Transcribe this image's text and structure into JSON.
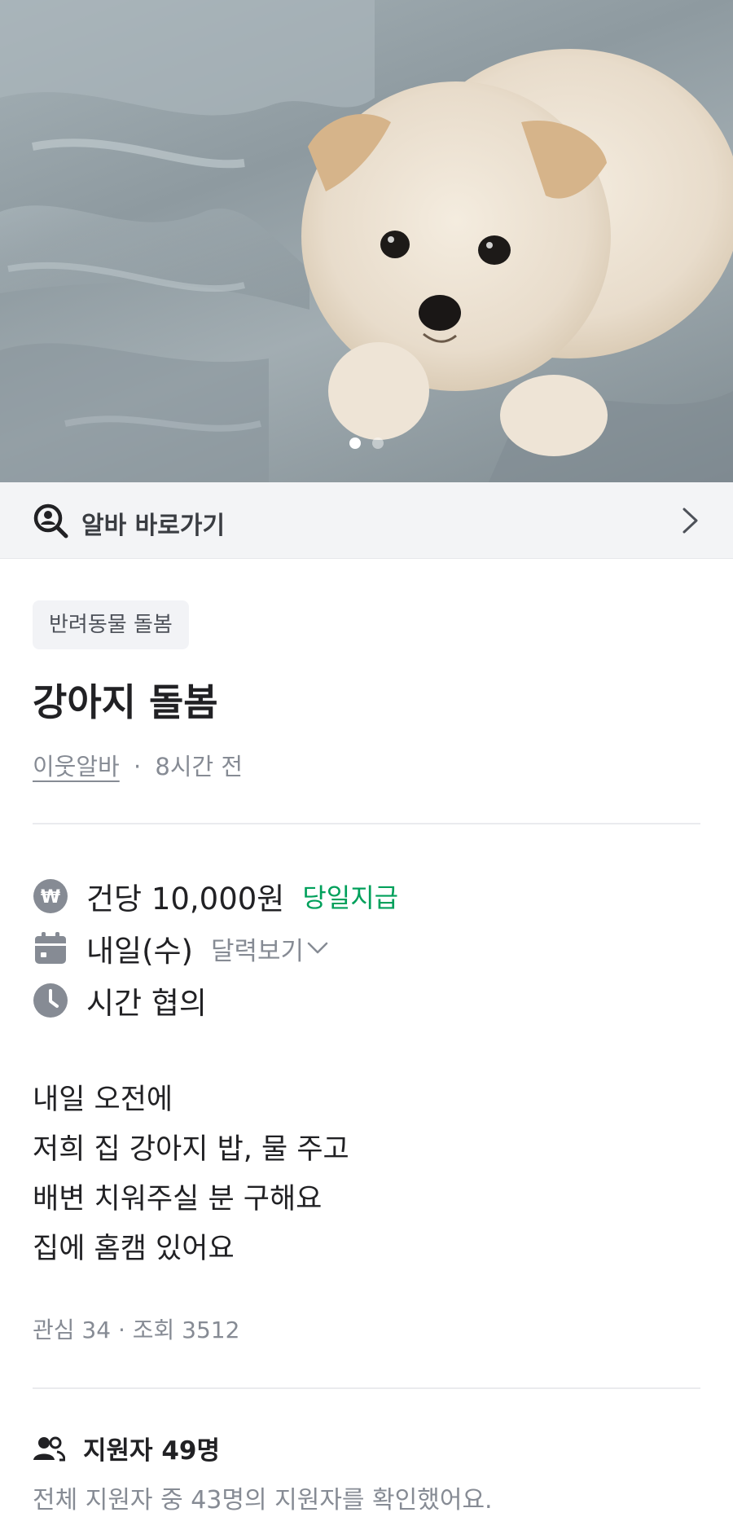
{
  "hero": {
    "image_subject": "puppy-on-blanket",
    "page_count": 2,
    "active_page": 1
  },
  "shortcut": {
    "label": "알바 바로가기",
    "icon": "search-person-icon",
    "arrow_icon": "chevron-right-icon"
  },
  "post": {
    "category": "반려동물 돌봄",
    "title": "강아지 돌봄",
    "author": "이웃알바",
    "separator": "·",
    "time_ago": "8시간 전"
  },
  "details": {
    "pay": "건당 10,000원",
    "pay_tag": "당일지급",
    "date": "내일(수)",
    "calendar_link": "달력보기",
    "time": "시간 협의"
  },
  "description": [
    "내일 오전에",
    "저희 집 강아지 밥, 물 주고",
    "배변 치워주실 분 구해요",
    "집에 홈캠 있어요"
  ],
  "stats": {
    "text": "관심 34 · 조회 3512"
  },
  "applicants": {
    "title": "지원자 49명",
    "subtitle": "전체 지원자 중 43명의 지원자를 확인했어요."
  },
  "colors": {
    "accent_green": "#00a05b",
    "muted_text": "#868b94",
    "icon_gray": "#868b94"
  }
}
